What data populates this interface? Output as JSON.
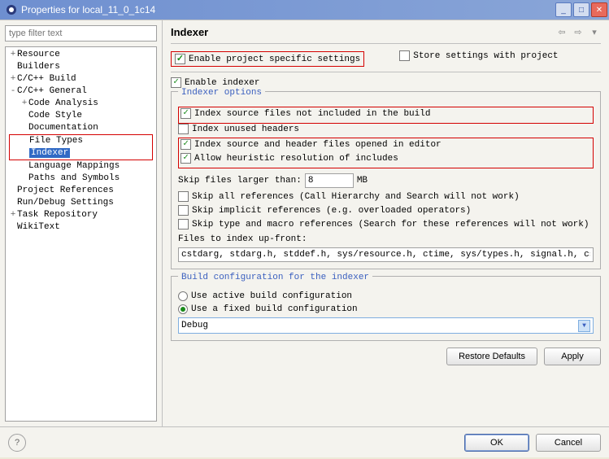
{
  "window": {
    "title": "Properties for local_11_0_1c14"
  },
  "filter": {
    "placeholder": "type filter text"
  },
  "tree": [
    {
      "label": "Resource",
      "tw": "+",
      "lvl": 0
    },
    {
      "label": "Builders",
      "tw": "",
      "lvl": 0
    },
    {
      "label": "C/C++ Build",
      "tw": "+",
      "lvl": 0
    },
    {
      "label": "C/C++ General",
      "tw": "-",
      "lvl": 0
    },
    {
      "label": "Code Analysis",
      "tw": "+",
      "lvl": 1
    },
    {
      "label": "Code Style",
      "tw": "",
      "lvl": 1
    },
    {
      "label": "Documentation",
      "tw": "",
      "lvl": 1
    },
    {
      "label": "File Types",
      "tw": "",
      "lvl": 1,
      "red": "tb"
    },
    {
      "label": "Indexer",
      "tw": "",
      "lvl": 1,
      "selected": true,
      "red": "lrb"
    },
    {
      "label": "Language Mappings",
      "tw": "",
      "lvl": 1
    },
    {
      "label": "Paths and Symbols",
      "tw": "",
      "lvl": 1
    },
    {
      "label": "Project References",
      "tw": "",
      "lvl": 0
    },
    {
      "label": "Run/Debug Settings",
      "tw": "",
      "lvl": 0
    },
    {
      "label": "Task Repository",
      "tw": "+",
      "lvl": 0
    },
    {
      "label": "WikiText",
      "tw": "",
      "lvl": 0
    }
  ],
  "main": {
    "title": "Indexer",
    "enable_specific": "Enable project specific settings",
    "store_settings": "Store settings with project",
    "enable_indexer": "Enable indexer",
    "opts_legend": "Indexer options",
    "o1": "Index source files not included in the build",
    "o2": "Index unused headers",
    "o3": "Index source and header files opened in editor",
    "o4": "Allow heuristic resolution of includes",
    "skip_label_pre": "Skip files larger than:",
    "skip_value": "8",
    "skip_unit": "MB",
    "s1": "Skip all references (Call Hierarchy and Search will not work)",
    "s2": "Skip implicit references (e.g. overloaded operators)",
    "s3": "Skip type and macro references (Search for these references will not work)",
    "upfront_label": "Files to index up-front:",
    "upfront_value": "cstdarg, stdarg.h, stddef.h, sys/resource.h, ctime, sys/types.h, signal.h, cstdio",
    "build_legend": "Build configuration for the indexer",
    "r1": "Use active build configuration",
    "r2": "Use a fixed build configuration",
    "select_value": "Debug",
    "restore": "Restore Defaults",
    "apply": "Apply"
  },
  "footer": {
    "ok": "OK",
    "cancel": "Cancel"
  }
}
